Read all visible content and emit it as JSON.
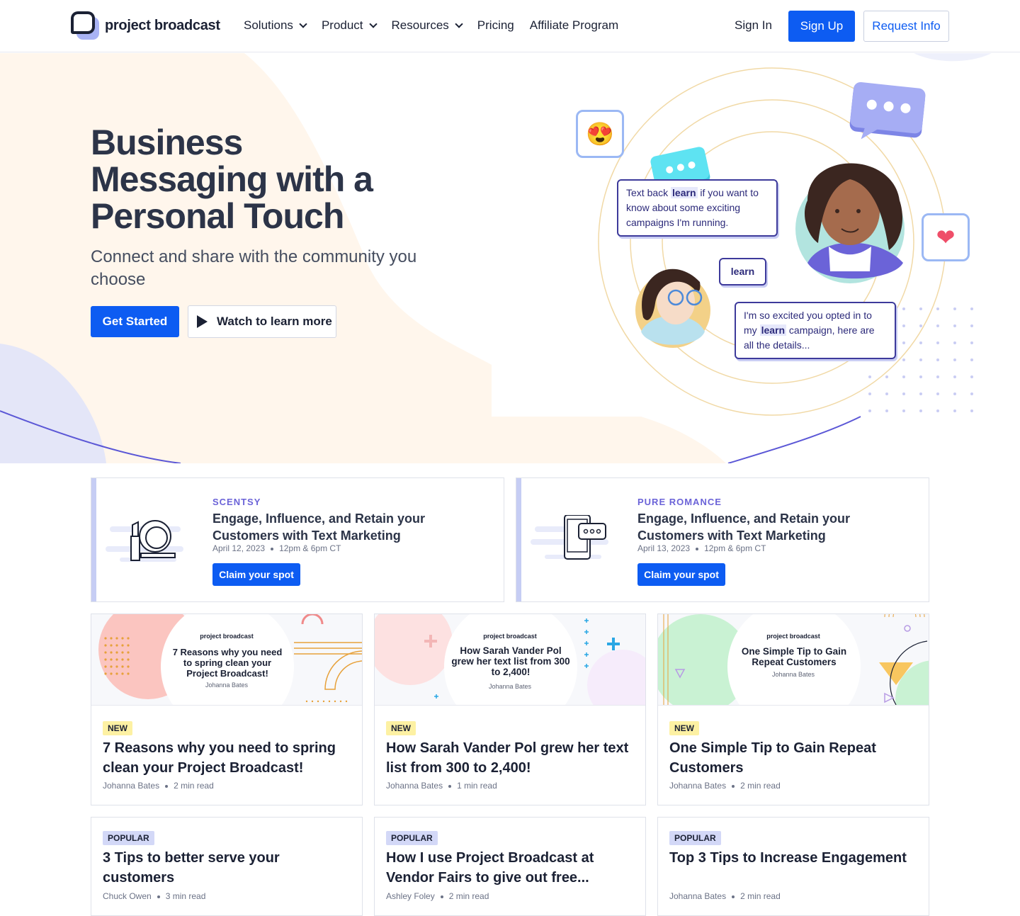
{
  "nav": {
    "logo_text": "project broadcast",
    "menu": [
      {
        "label": "Solutions",
        "dropdown": true
      },
      {
        "label": "Product",
        "dropdown": true
      },
      {
        "label": "Resources",
        "dropdown": true
      },
      {
        "label": "Pricing",
        "dropdown": false
      },
      {
        "label": "Affiliate Program",
        "dropdown": false
      }
    ],
    "sign_in": "Sign In",
    "sign_up": "Sign Up",
    "request_info": "Request Info"
  },
  "hero": {
    "title_line1": "Business",
    "title_line2": "Messaging with a",
    "title_line3": "Personal Touch",
    "subtitle": "Connect and share with the community you choose",
    "get_started": "Get Started",
    "watch": "Watch to learn more",
    "bubble1_pre": "Text back ",
    "bubble1_keyword": "learn",
    "bubble1_post": " if you want to know about some exciting campaigns I'm running.",
    "bubble2": "learn",
    "bubble3_pre": "I'm so excited you opted in to my ",
    "bubble3_keyword": "learn",
    "bubble3_post": " campaign, here are all the details...",
    "emoji_face": "😍",
    "emoji_heart": "❤"
  },
  "webinars": [
    {
      "brand": "SCENTSY",
      "title": "Engage, Influence, and Retain your Customers with Text Marketing",
      "date": "April 12, 2023",
      "time": "12pm & 6pm CT",
      "cta": "Claim your spot",
      "icon": "lipstick-mirror-icon"
    },
    {
      "brand": "PURE ROMANCE",
      "title": "Engage, Influence, and Retain your Customers with Text Marketing",
      "date": "April 13, 2023",
      "time": "12pm & 6pm CT",
      "cta": "Claim your spot",
      "icon": "phone-message-icon"
    }
  ],
  "articles": [
    {
      "badge": "NEW",
      "title": "7 Reasons why you need to spring clean your Project Broadcast!",
      "author": "Johanna Bates",
      "read": "2 min read",
      "thumb_title": "7 Reasons why you need to spring clean your Project Broadcast!",
      "thumb_logo": "project broadcast",
      "thumb_author": "Johanna Bates"
    },
    {
      "badge": "NEW",
      "title": "How Sarah Vander Pol grew her text list from 300 to 2,400!",
      "author": "Johanna Bates",
      "read": "1 min read",
      "thumb_title": "How Sarah Vander Pol grew her text list from 300 to 2,400!",
      "thumb_logo": "project broadcast",
      "thumb_author": "Johanna Bates"
    },
    {
      "badge": "NEW",
      "title": "One Simple Tip to Gain Repeat Customers",
      "author": "Johanna Bates",
      "read": "2 min read",
      "thumb_title": "One Simple Tip to Gain Repeat Customers",
      "thumb_logo": "project broadcast",
      "thumb_author": "Johanna Bates"
    },
    {
      "badge": "POPULAR",
      "title": "3 Tips to better serve your customers",
      "author": "Chuck Owen",
      "read": "3 min read"
    },
    {
      "badge": "POPULAR",
      "title": "How I use Project Broadcast at Vendor Fairs to give out free...",
      "author": "Ashley Foley",
      "read": "2 min read"
    },
    {
      "badge": "POPULAR",
      "title": "Top 3 Tips to Increase Engagement",
      "author": "Johanna Bates",
      "read": "2 min read"
    }
  ],
  "colors": {
    "primary": "#0d5cf2",
    "accent": "#6b63d8",
    "new_badge": "#fdf1a3",
    "popular_badge": "#d3d8f7",
    "hero_bg": "#fff6ec"
  }
}
